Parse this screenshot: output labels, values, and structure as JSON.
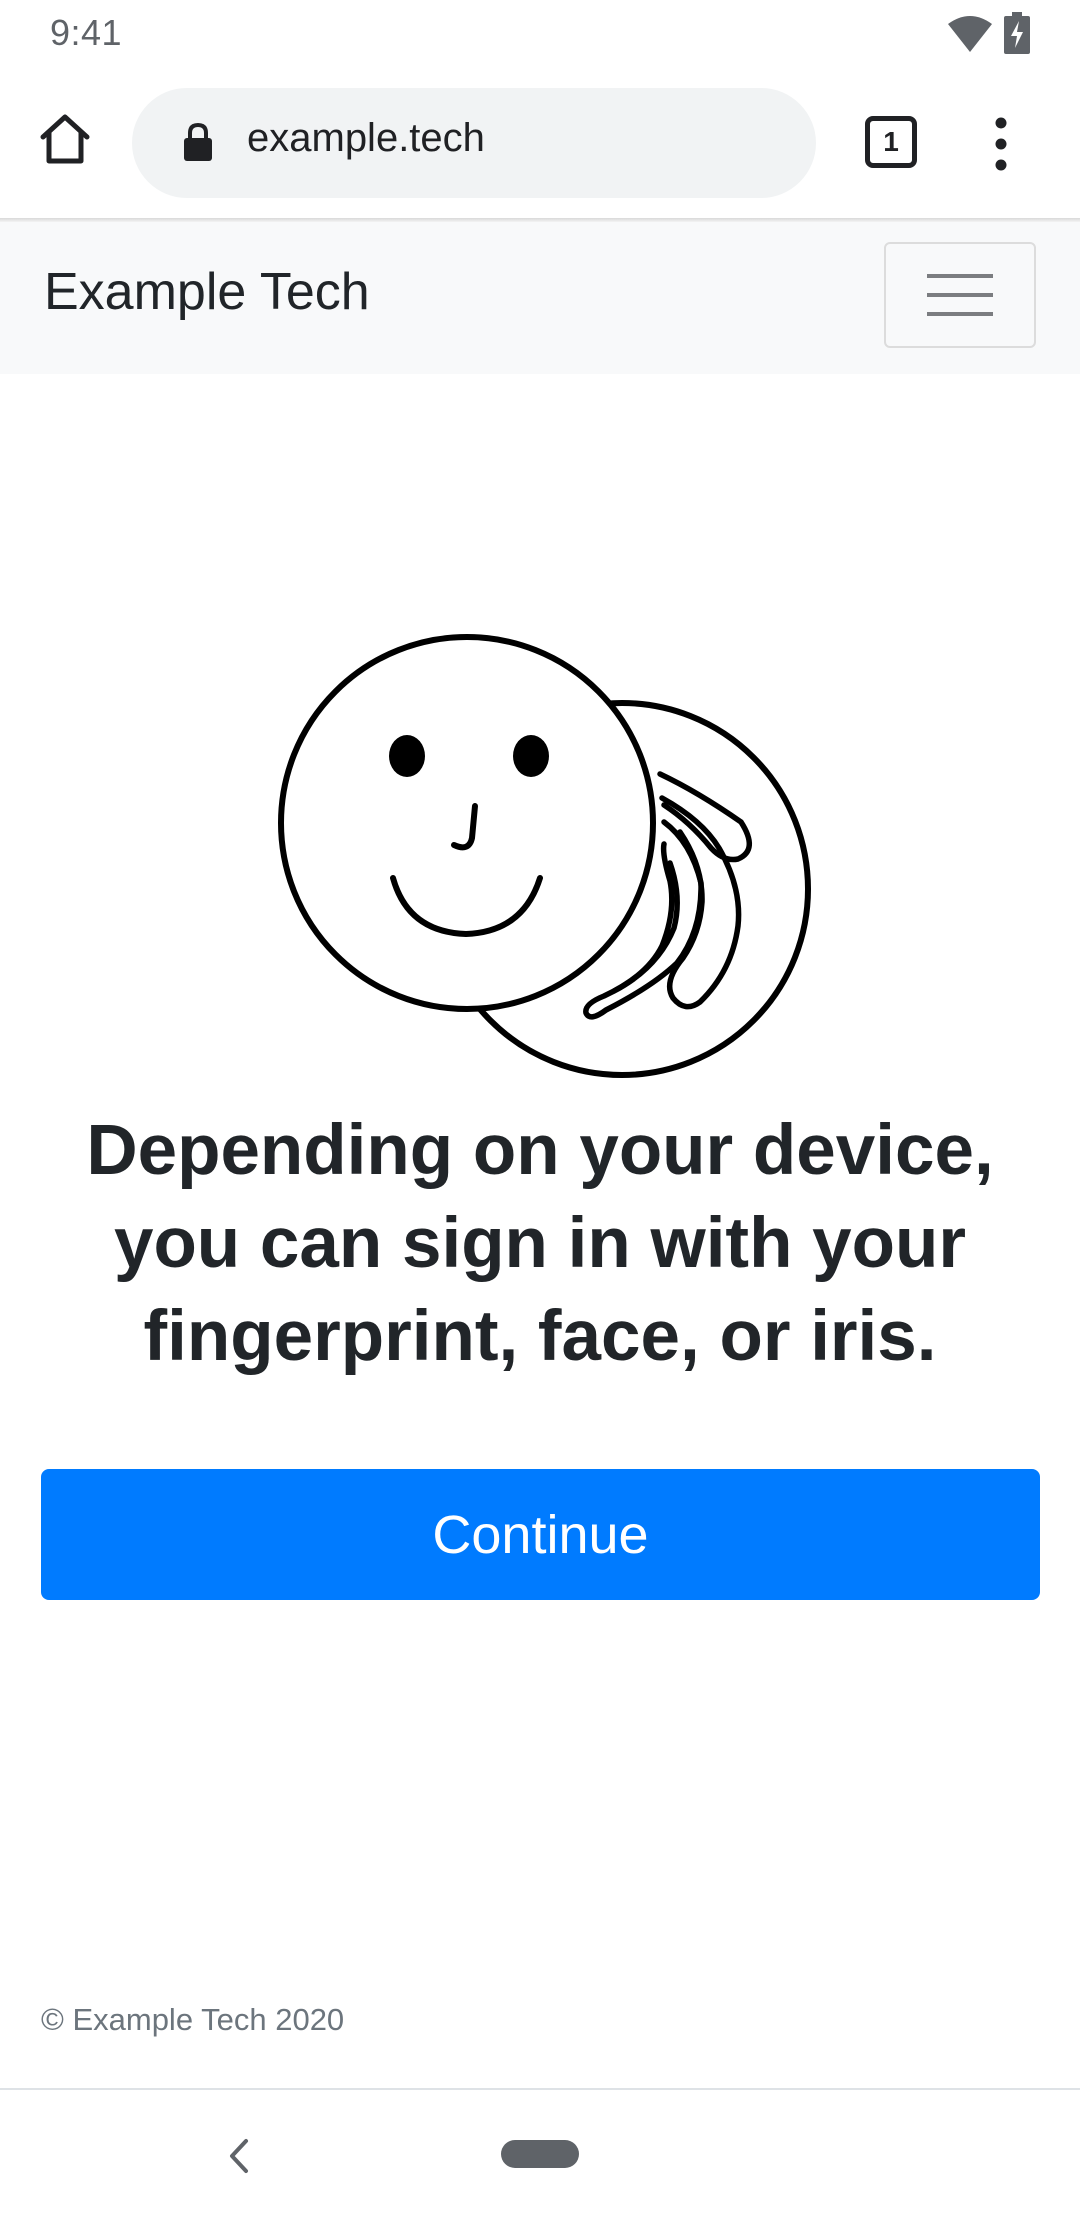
{
  "status_bar": {
    "time": "9:41",
    "icons": [
      "wifi-icon",
      "battery-charging-icon"
    ]
  },
  "browser": {
    "url": "example.tech",
    "tab_count": "1",
    "icons": {
      "home": "home-icon",
      "lock": "lock-icon",
      "menu": "more-vert-icon"
    }
  },
  "navbar": {
    "brand": "Example Tech",
    "toggler_icon": "hamburger-menu-icon"
  },
  "main": {
    "illustration": "face-and-fingerprint-illustration",
    "heading": "Depending on your device, you can sign in with your fingerprint, face, or iris.",
    "continue_label": "Continue"
  },
  "footer": {
    "text": "© Example Tech 2020"
  },
  "system_nav": {
    "icons": [
      "back-icon",
      "home-pill"
    ]
  },
  "colors": {
    "primary": "#007bff",
    "navbar_bg": "#f8f9fa",
    "text": "#212529",
    "muted": "#6c757d",
    "url_bar_bg": "#f1f3f4"
  }
}
